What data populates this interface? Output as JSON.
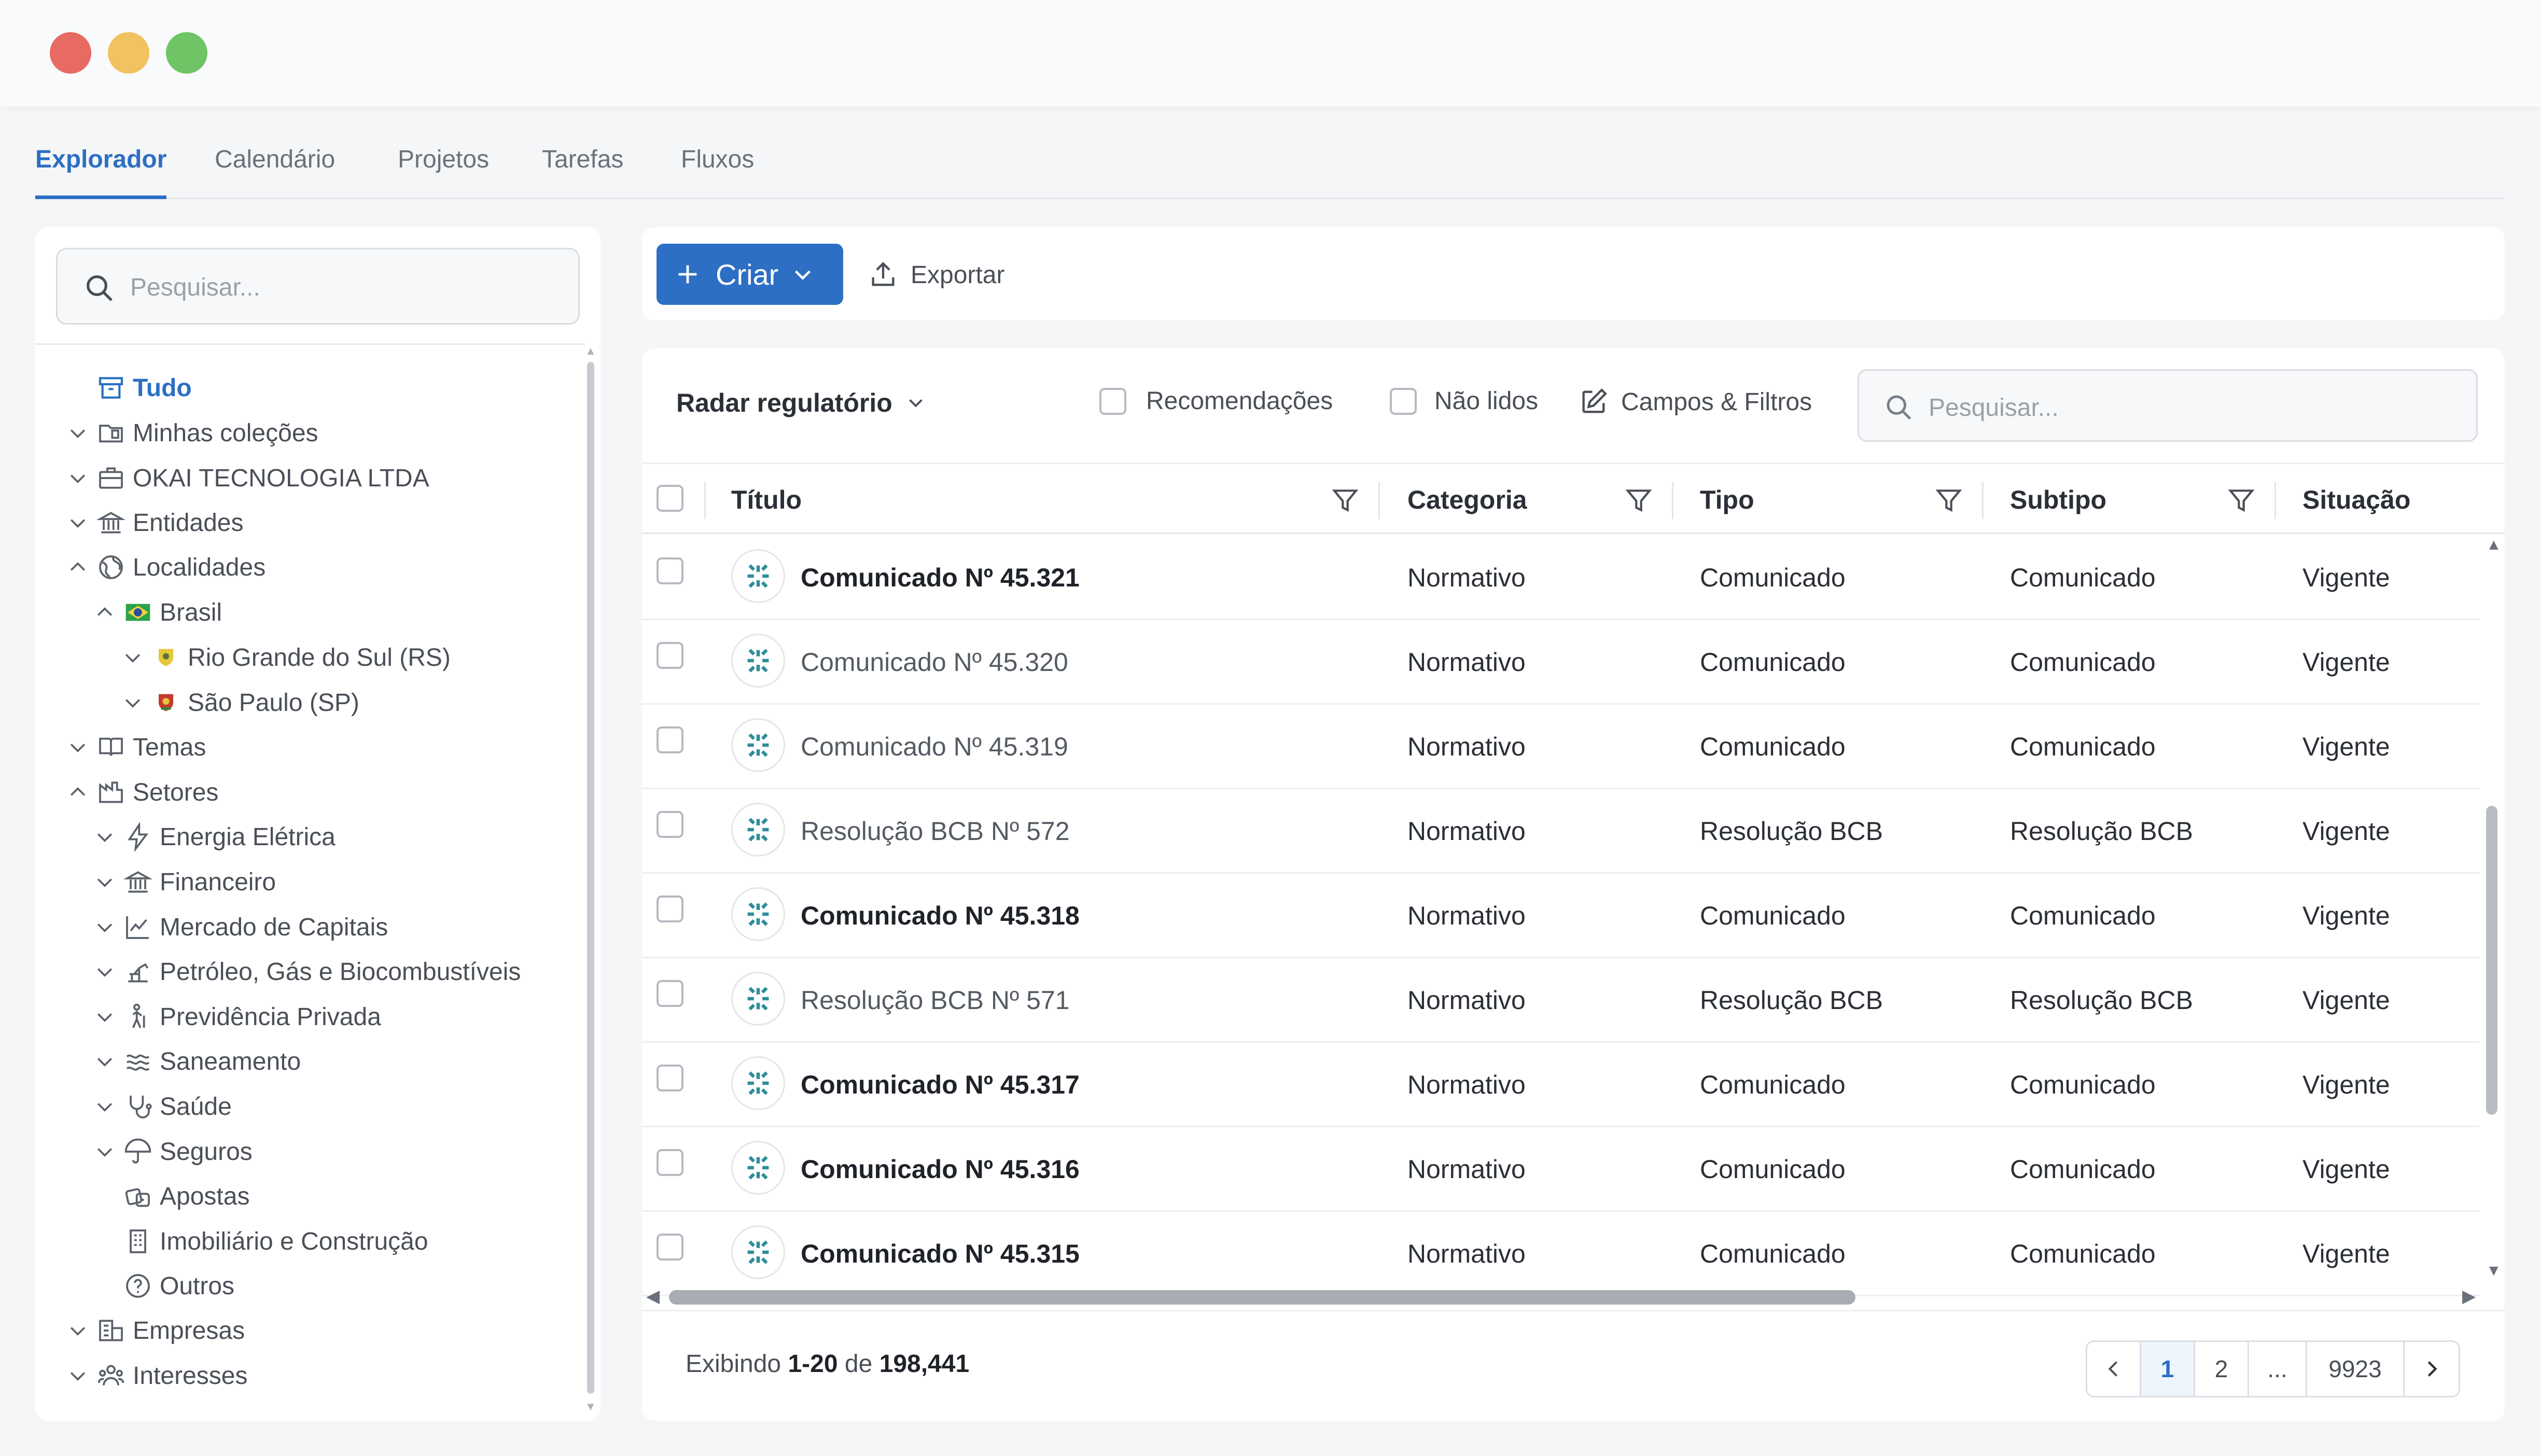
{
  "window": {
    "controls": [
      "close",
      "minimize",
      "maximize"
    ]
  },
  "tabs": [
    {
      "label": "Explorador",
      "active": true
    },
    {
      "label": "Calendário",
      "active": false
    },
    {
      "label": "Projetos",
      "active": false
    },
    {
      "label": "Tarefas",
      "active": false
    },
    {
      "label": "Fluxos",
      "active": false
    }
  ],
  "sidebar": {
    "search_placeholder": "Pesquisar...",
    "items": [
      {
        "label": "Tudo",
        "icon": "archive-icon",
        "selected": true
      },
      {
        "label": "Minhas coleções",
        "icon": "folder-icon",
        "expander": "down"
      },
      {
        "label": "OKAI TECNOLOGIA LTDA",
        "icon": "briefcase-icon",
        "expander": "down"
      },
      {
        "label": "Entidades",
        "icon": "institution-icon",
        "expander": "down"
      },
      {
        "label": "Localidades",
        "icon": "globe-icon",
        "expander": "up"
      },
      {
        "label": "Brasil",
        "icon": "brazil-flag-icon",
        "expander": "up"
      },
      {
        "label": "Rio Grande do Sul (RS)",
        "icon": "rs-coat-of-arms-icon",
        "expander": "down"
      },
      {
        "label": "São Paulo (SP)",
        "icon": "sp-coat-of-arms-icon",
        "expander": "down"
      },
      {
        "label": "Temas",
        "icon": "book-icon",
        "expander": "down"
      },
      {
        "label": "Setores",
        "icon": "factory-icon",
        "expander": "up"
      },
      {
        "label": "Energia Elétrica",
        "icon": "lightning-icon",
        "expander": "down"
      },
      {
        "label": "Financeiro",
        "icon": "bank-icon",
        "expander": "down"
      },
      {
        "label": "Mercado de Capitais",
        "icon": "line-chart-icon",
        "expander": "down"
      },
      {
        "label": "Petróleo, Gás e Biocombustíveis",
        "icon": "oil-pump-icon",
        "expander": "down"
      },
      {
        "label": "Previdência Privada",
        "icon": "elderly-icon",
        "expander": "down"
      },
      {
        "label": "Saneamento",
        "icon": "water-icon",
        "expander": "down"
      },
      {
        "label": "Saúde",
        "icon": "stethoscope-icon",
        "expander": "down"
      },
      {
        "label": "Seguros",
        "icon": "umbrella-icon",
        "expander": "down"
      },
      {
        "label": "Apostas",
        "icon": "dice-icon"
      },
      {
        "label": "Imobiliário e Construção",
        "icon": "building-icon"
      },
      {
        "label": "Outros",
        "icon": "question-circle-icon"
      },
      {
        "label": "Empresas",
        "icon": "company-icon",
        "expander": "down"
      },
      {
        "label": "Interesses",
        "icon": "people-icon",
        "expander": "down"
      }
    ]
  },
  "toolbar": {
    "create_label": "Criar",
    "export_label": "Exportar"
  },
  "filters": {
    "radar_label": "Radar regulatório",
    "recommendations_label": "Recomendações",
    "unread_label": "Não lidos",
    "fields_filters_label": "Campos & Filtros",
    "search_placeholder": "Pesquisar..."
  },
  "table": {
    "columns": [
      "Título",
      "Categoria",
      "Tipo",
      "Subtipo",
      "Situação"
    ],
    "rows": [
      {
        "title": "Comunicado Nº 45.321",
        "unread": true,
        "category": "Normativo",
        "type": "Comunicado",
        "subtype": "Comunicado",
        "status": "Vigente"
      },
      {
        "title": "Comunicado Nº 45.320",
        "unread": false,
        "category": "Normativo",
        "type": "Comunicado",
        "subtype": "Comunicado",
        "status": "Vigente"
      },
      {
        "title": "Comunicado Nº 45.319",
        "unread": false,
        "category": "Normativo",
        "type": "Comunicado",
        "subtype": "Comunicado",
        "status": "Vigente"
      },
      {
        "title": "Resolução BCB Nº 572",
        "unread": false,
        "category": "Normativo",
        "type": "Resolução BCB",
        "subtype": "Resolução BCB",
        "status": "Vigente"
      },
      {
        "title": "Comunicado Nº 45.318",
        "unread": true,
        "category": "Normativo",
        "type": "Comunicado",
        "subtype": "Comunicado",
        "status": "Vigente"
      },
      {
        "title": "Resolução BCB Nº 571",
        "unread": false,
        "category": "Normativo",
        "type": "Resolução BCB",
        "subtype": "Resolução BCB",
        "status": "Vigente"
      },
      {
        "title": "Comunicado Nº 45.317",
        "unread": true,
        "category": "Normativo",
        "type": "Comunicado",
        "subtype": "Comunicado",
        "status": "Vigente"
      },
      {
        "title": "Comunicado Nº 45.316",
        "unread": true,
        "category": "Normativo",
        "type": "Comunicado",
        "subtype": "Comunicado",
        "status": "Vigente"
      },
      {
        "title": "Comunicado Nº 45.315",
        "unread": true,
        "category": "Normativo",
        "type": "Comunicado",
        "subtype": "Comunicado",
        "status": "Vigente"
      }
    ]
  },
  "footer": {
    "showing_prefix": "Exibindo",
    "range": "1-20",
    "of_label": "de",
    "total": "198,441",
    "pages": [
      "1",
      "2",
      "...",
      "9923"
    ],
    "current_page": "1"
  },
  "colors": {
    "accent": "#2c6fc4",
    "text": "#2b2f36",
    "muted": "#6b717b",
    "avatar": "#2f8d9a"
  }
}
